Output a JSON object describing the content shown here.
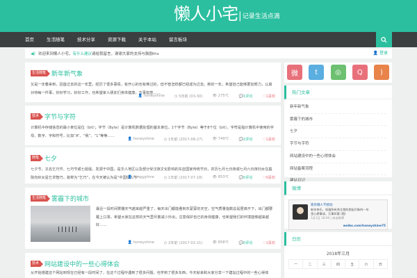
{
  "header": {
    "logo_main": "懒人小宅",
    "logo_sep": "|",
    "logo_sub": "记录生活点滴"
  },
  "nav": {
    "items": [
      "首页",
      "生活随笔",
      "技术分享",
      "资源下载",
      "关于本站",
      "留言板块"
    ],
    "search_icon": "search-icon"
  },
  "notice": {
    "prefix": "欢迎来到懒人小宅，",
    "highlight": "有什么建议",
    "suffix": "请给我留言，谢谢大家的支持与鼓励thx",
    "user_label": "登录"
  },
  "posts": [
    {
      "category": "生活随笔",
      "title": "新年新气象",
      "excerpt": "又是一年春来到，回首过去的这一年里，经历了很多事情，有开心的也有难过的，但不管怎样都已经成为过去。新的一年，希望自己能够更加努力，认真对待每一件事，好好学习，好好工作，也希望家人朋友们身体健康，万事如意……",
      "author": "honeyshine",
      "date": "5年前 (03-30)",
      "views": "275℃",
      "comments": "1评论",
      "likes": "1喜欢"
    },
    {
      "category": "技术",
      "title": "字节与字符",
      "excerpt": "计算机中存储信息的最小单位是位（bit）；字节（Byte）是计算机数据处理的基本单位，1个字节（Byte）等于8个位（bit）。字符是指计算机中使用的字母、数字、字和符号，比如“A”、“我”、“1”等等……",
      "author": "honeyshine",
      "date": "1年前 (2017-08-27)",
      "views": "749℃",
      "comments": "2评论",
      "likes": "1喜欢"
    },
    {
      "category": "随笔",
      "title": "七夕",
      "excerpt": "七夕节，又名乞巧节、七巧节或七姐诞，发源于中国，是华人地区以及部分受汉族文化影响的东亚国家传统节日，农历七月七日夜或七月六日夜妇女在庭院向织女星乞求智巧，故称为“乞巧”，在今天被认为是“中国情人节”……",
      "author": "honeyshine",
      "date": "1年前 (2017-07-18)",
      "views": "853℃",
      "comments": "0评论",
      "likes": "0喜欢"
    },
    {
      "category": "生活随笔",
      "title": "雾霾下的城市",
      "excerpt": "最近一段时间雾霾天气越来越严重了，每天出门都能看到灰蒙蒙的天空，空气质量指数总是居高不下，出门都要戴上口罩，希望大家在这样的天气里尽量减少外出，注意保护自己的身体健康，也希望我们的环境能够越来越好……",
      "author": "honeyshine",
      "date": "2年前 (2017-02-21)",
      "views": "858℃",
      "comments": "0评论",
      "likes": "1喜欢"
    },
    {
      "category": "技术",
      "title": "网站建设中的一些心得体会",
      "excerpt": "从开始搭建这个网站到现在已经有一段时间了，在这个过程中遇到了很多问题，也学到了很多东西，今天就来和大家分享一下建站过程中的一些心得体会，希望对大家有所帮助……",
      "author": "",
      "date": "",
      "views": "",
      "comments": "",
      "likes": ""
    }
  ],
  "social": {
    "icons": [
      "weibo-icon",
      "twitter-icon",
      "wechat-icon",
      "qq-icon",
      "rss-icon"
    ],
    "colors": [
      "#e8707a",
      "#5aaee0",
      "#6cc070",
      "#e8707a",
      "#e8834a"
    ]
  },
  "widgets": {
    "popular": {
      "title": "热门文章",
      "items": [
        "新年新气象",
        "雾霾下的城市",
        "七夕",
        "字节与字符",
        "网站建设中的一些心得体会",
        "网站备案流程",
        "建站日记"
      ]
    },
    "weibo": {
      "title": "微博",
      "name": "家有懒人不想动",
      "text": "新年快乐，祝福所有关注我的朋友们新的一年里心想事成，万事如意 (图)",
      "time": "1月1日 18:00 | 来自微博",
      "link": "weibo.com/honeyshine75"
    },
    "calendar": {
      "title": "日历",
      "caption": "2018年三月",
      "weekdays": [
        "一",
        "二",
        "三",
        "四",
        "五",
        "六",
        "日"
      ]
    }
  },
  "colors": {
    "accent": "#2bbf9f",
    "nav_bg": "#3b3f3f",
    "category": "#d9534f",
    "likes": "#e8707a"
  }
}
